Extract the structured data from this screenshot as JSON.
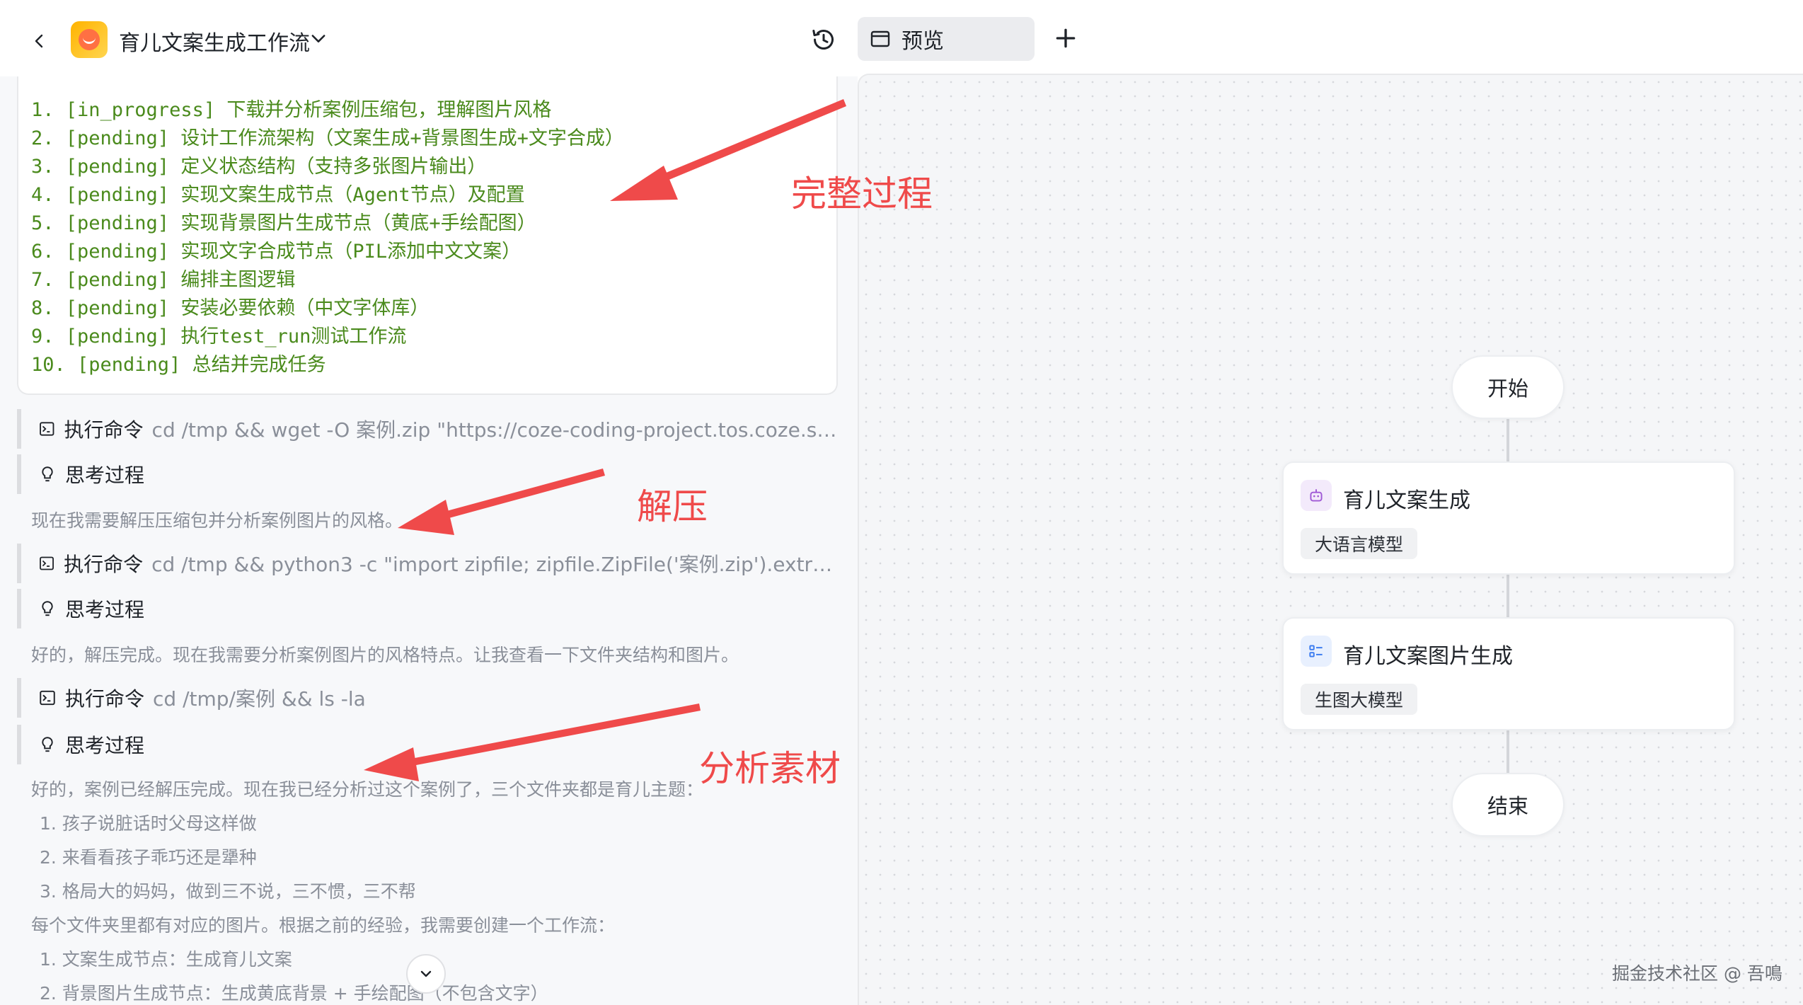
{
  "header": {
    "back_icon": "chevron-left-icon",
    "app_title": "育儿文案生成工作流",
    "title_dropdown_icon": "chevron-down-icon",
    "history_icon": "history-icon",
    "preview_tab_label": "预览",
    "preview_tab_icon": "browser-window-icon",
    "add_tab_icon": "plus-icon"
  },
  "todo": {
    "lines": [
      "1. [in_progress] 下载并分析案例压缩包，理解图片风格",
      "2. [pending] 设计工作流架构（文案生成+背景图生成+文字合成）",
      "3. [pending] 定义状态结构（支持多张图片输出）",
      "4. [pending] 实现文案生成节点（Agent节点）及配置",
      "5. [pending] 实现背景图片生成节点（黄底+手绘配图）",
      "6. [pending] 实现文字合成节点（PIL添加中文文案）",
      "7. [pending] 编排主图逻辑",
      "8. [pending] 安装必要依赖（中文字体库）",
      "9. [pending] 执行test_run测试工作流",
      "10. [pending] 总结并完成任务"
    ]
  },
  "log": {
    "cmd_label": "执行命令",
    "think_label": "思考过程",
    "cmd1": "cd /tmp && wget -O 案例.zip \"https://coze-coding-project.tos.coze.site/c...",
    "think1": "现在我需要解压压缩包并分析案例图片的风格。",
    "cmd2": "cd /tmp && python3 -c \"import zipfile; zipfile.ZipFile('案例.zip').extractall(...",
    "think2": "好的，解压完成。现在我需要分析案例图片的风格特点。让我查看一下文件夹结构和图片。",
    "cmd3": "cd /tmp/案例 && ls -la",
    "think3": "好的，案例已经解压完成。现在我已经分析过这个案例了，三个文件夹都是育儿主题：",
    "folders": [
      "1.  孩子说脏话时父母这样做",
      "2.  来看看孩子乖巧还是犟种",
      "3.  格局大的妈妈，做到三不说，三不惯，三不帮"
    ],
    "plan_intro": "每个文件夹里都有对应的图片。根据之前的经验，我需要创建一个工作流：",
    "plan": [
      "1.  文案生成节点：生成育儿文案",
      "2.  背景图片生成节点：生成黄底背景 + 手绘配图（不包含文字）"
    ]
  },
  "annotations": {
    "complete_process": "完整过程",
    "unzip": "解压",
    "analyze_material": "分析素材",
    "color": "#ef4a4a"
  },
  "workflow": {
    "start_label": "开始",
    "end_label": "结束",
    "nodes": [
      {
        "title": "育儿文案生成",
        "tag": "大语言模型",
        "icon": "robot-icon",
        "icon_color": "#a05ad6",
        "icon_bg": "#f3eafb"
      },
      {
        "title": "育儿文案图片生成",
        "tag": "生图大模型",
        "icon": "image-list-icon",
        "icon_color": "#3a7bf0",
        "icon_bg": "#e8f0fe"
      }
    ]
  },
  "watermark": "掘金技术社区 @ 吾鳴"
}
